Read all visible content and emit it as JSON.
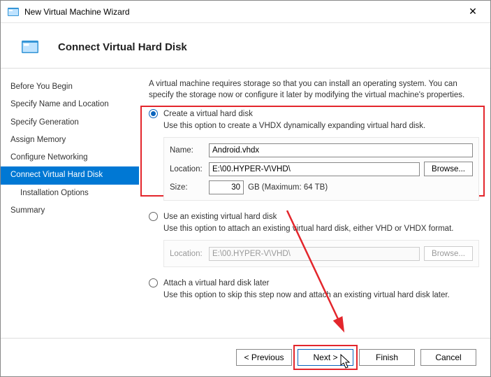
{
  "window": {
    "title": "New Virtual Machine Wizard"
  },
  "header": {
    "title": "Connect Virtual Hard Disk"
  },
  "sidebar": {
    "items": [
      {
        "label": "Before You Begin"
      },
      {
        "label": "Specify Name and Location"
      },
      {
        "label": "Specify Generation"
      },
      {
        "label": "Assign Memory"
      },
      {
        "label": "Configure Networking"
      },
      {
        "label": "Connect Virtual Hard Disk",
        "active": true
      },
      {
        "label": "Installation Options",
        "indent": true
      },
      {
        "label": "Summary"
      }
    ]
  },
  "main": {
    "intro": "A virtual machine requires storage so that you can install an operating system. You can specify the storage now or configure it later by modifying the virtual machine's properties.",
    "option_create": {
      "label": "Create a virtual hard disk",
      "desc": "Use this option to create a VHDX dynamically expanding virtual hard disk.",
      "name_label": "Name:",
      "name_value": "Android.vhdx",
      "location_label": "Location:",
      "location_value": "E:\\00.HYPER-V\\VHD\\",
      "browse_label": "Browse...",
      "size_label": "Size:",
      "size_value": "30",
      "size_note": "GB (Maximum: 64 TB)"
    },
    "option_existing": {
      "label": "Use an existing virtual hard disk",
      "desc": "Use this option to attach an existing virtual hard disk, either VHD or VHDX format.",
      "location_label": "Location:",
      "location_value": "E:\\00.HYPER-V\\VHD\\",
      "browse_label": "Browse..."
    },
    "option_later": {
      "label": "Attach a virtual hard disk later",
      "desc": "Use this option to skip this step now and attach an existing virtual hard disk later."
    }
  },
  "footer": {
    "previous": "< Previous",
    "next": "Next >",
    "finish": "Finish",
    "cancel": "Cancel"
  }
}
